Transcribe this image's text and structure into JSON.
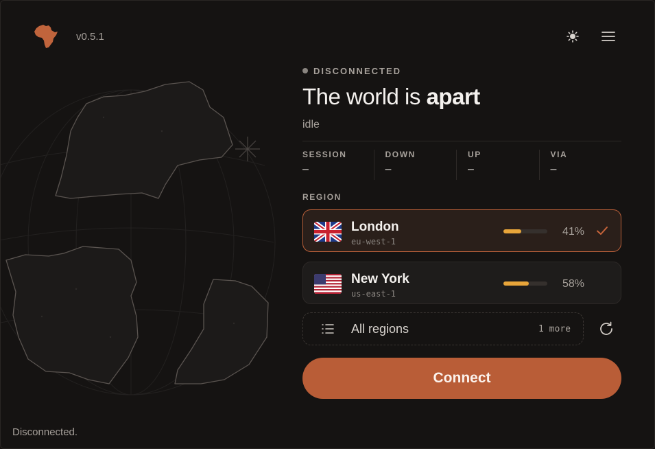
{
  "header": {
    "version": "v0.5.1",
    "logo_icon": "africa-logo-icon",
    "theme_icon": "sun-icon",
    "menu_icon": "hamburger-menu-icon"
  },
  "status": {
    "label": "DISCONNECTED",
    "headline_prefix": "The world is ",
    "headline_emphasis": "apart",
    "subtext": "idle"
  },
  "stats": [
    {
      "label": "SESSION",
      "value": "–"
    },
    {
      "label": "DOWN",
      "value": "–"
    },
    {
      "label": "UP",
      "value": "–"
    },
    {
      "label": "VIA",
      "value": "–"
    }
  ],
  "region": {
    "label": "REGION",
    "items": [
      {
        "city": "London",
        "code": "eu-west-1",
        "load_percent": 41,
        "load_label": "41%",
        "flag": "uk-flag-icon",
        "selected": true
      },
      {
        "city": "New York",
        "code": "us-east-1",
        "load_percent": 58,
        "load_label": "58%",
        "flag": "us-flag-icon",
        "selected": false
      }
    ],
    "all_label": "All regions",
    "more_label": "1 more"
  },
  "connect_label": "Connect",
  "footer_status": "Disconnected.",
  "colors": {
    "accent": "#b95d37",
    "load": "#e8a53a",
    "background": "#151312"
  }
}
